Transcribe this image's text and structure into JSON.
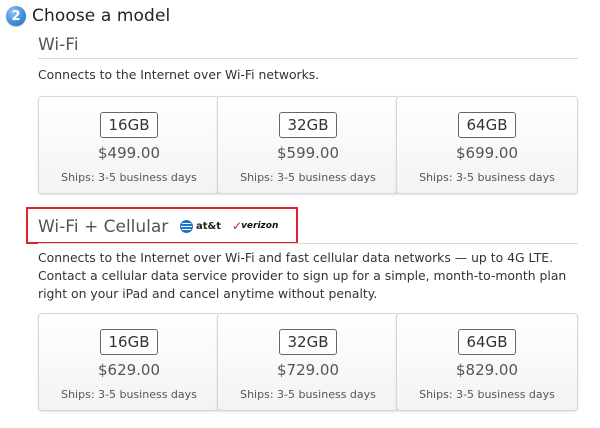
{
  "step": {
    "number": "2",
    "title": "Choose a model"
  },
  "wifi": {
    "title": "Wi-Fi",
    "description": "Connects to the Internet over Wi-Fi networks.",
    "models": [
      {
        "capacity": "16GB",
        "price": "$499.00",
        "ships": "Ships: 3-5 business days"
      },
      {
        "capacity": "32GB",
        "price": "$599.00",
        "ships": "Ships: 3-5 business days"
      },
      {
        "capacity": "64GB",
        "price": "$699.00",
        "ships": "Ships: 3-5 business days"
      }
    ]
  },
  "cellular": {
    "title": "Wi-Fi + Cellular",
    "carriers": {
      "att": "at&t",
      "verizon": "verizon"
    },
    "description": "Connects to the Internet over Wi-Fi and fast cellular data networks — up to 4G LTE. Contact a cellular data service provider to sign up for a simple, month-to-month plan right on your iPad and cancel anytime without penalty.",
    "models": [
      {
        "capacity": "16GB",
        "price": "$629.00",
        "ships": "Ships: 3-5 business days"
      },
      {
        "capacity": "32GB",
        "price": "$729.00",
        "ships": "Ships: 3-5 business days"
      },
      {
        "capacity": "64GB",
        "price": "$829.00",
        "ships": "Ships: 3-5 business days"
      }
    ]
  },
  "colors": {
    "accent": "#3f8fdc",
    "highlight": "#e0222a",
    "verizon_red": "#d8121b",
    "att_blue": "#1e73c6"
  }
}
